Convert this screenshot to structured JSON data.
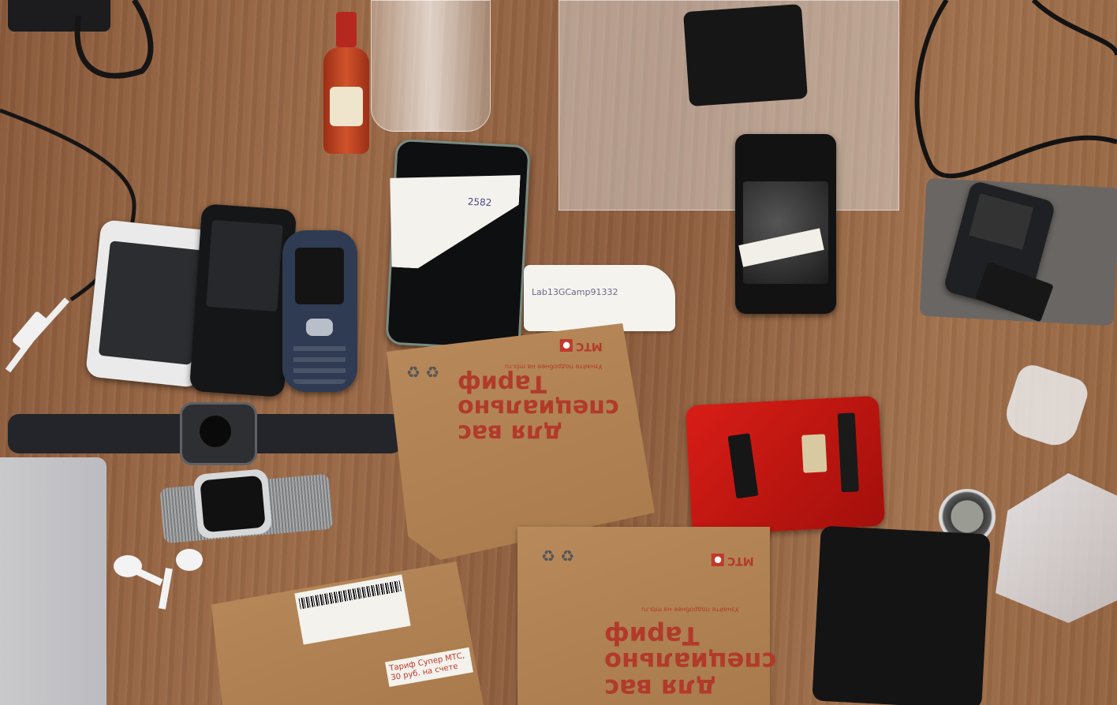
{
  "envelopes": {
    "center": {
      "brand": "МТС",
      "lines": [
        "Тариф",
        "специально",
        "для вас"
      ],
      "small": "Узнайте подробнее на mts.ru"
    },
    "bottom_center": {
      "brand": "МТС",
      "lines": [
        "Тариф",
        "специально",
        "для вас"
      ],
      "small": "Узнайте подробнее на mts.ru"
    },
    "bottom_left": {
      "sticker": "Тариф Супер МТС, 30 руб. на счете"
    }
  },
  "notes": {
    "phone_note": "2582",
    "card_note": "Lab13GCamp91332"
  },
  "colors": {
    "table": "#93633f",
    "kraft": "#b08152",
    "mts_red": "#c0392b",
    "red_case": "#c0150f"
  }
}
